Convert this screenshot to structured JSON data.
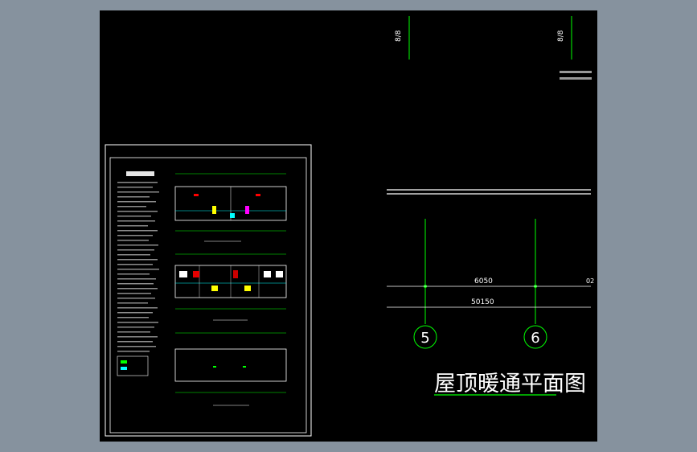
{
  "drawing": {
    "title": "屋顶暖通平面图",
    "axis_labels": [
      "5",
      "6"
    ],
    "dimension_top": "6050",
    "dimension_total": "50150",
    "dimension_right": "02",
    "north_marker_left": "8/8",
    "north_marker_right": "8/8"
  },
  "colors": {
    "background": "#86929e",
    "canvas": "#000000",
    "axis": "#00ff00",
    "line": "#ffffff",
    "accent_red": "#ff0000",
    "accent_cyan": "#00ffff",
    "accent_yellow": "#ffff00"
  }
}
